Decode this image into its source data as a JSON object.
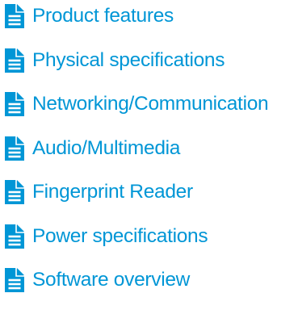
{
  "colors": {
    "link": "#0096d6",
    "icon_fold": "#ffffff"
  },
  "icon": "document-icon",
  "links": [
    {
      "label": "Product features"
    },
    {
      "label": "Physical specifications"
    },
    {
      "label": "Networking/Communication"
    },
    {
      "label": "Audio/Multimedia"
    },
    {
      "label": "Fingerprint Reader"
    },
    {
      "label": "Power specifications"
    },
    {
      "label": "Software overview"
    }
  ]
}
